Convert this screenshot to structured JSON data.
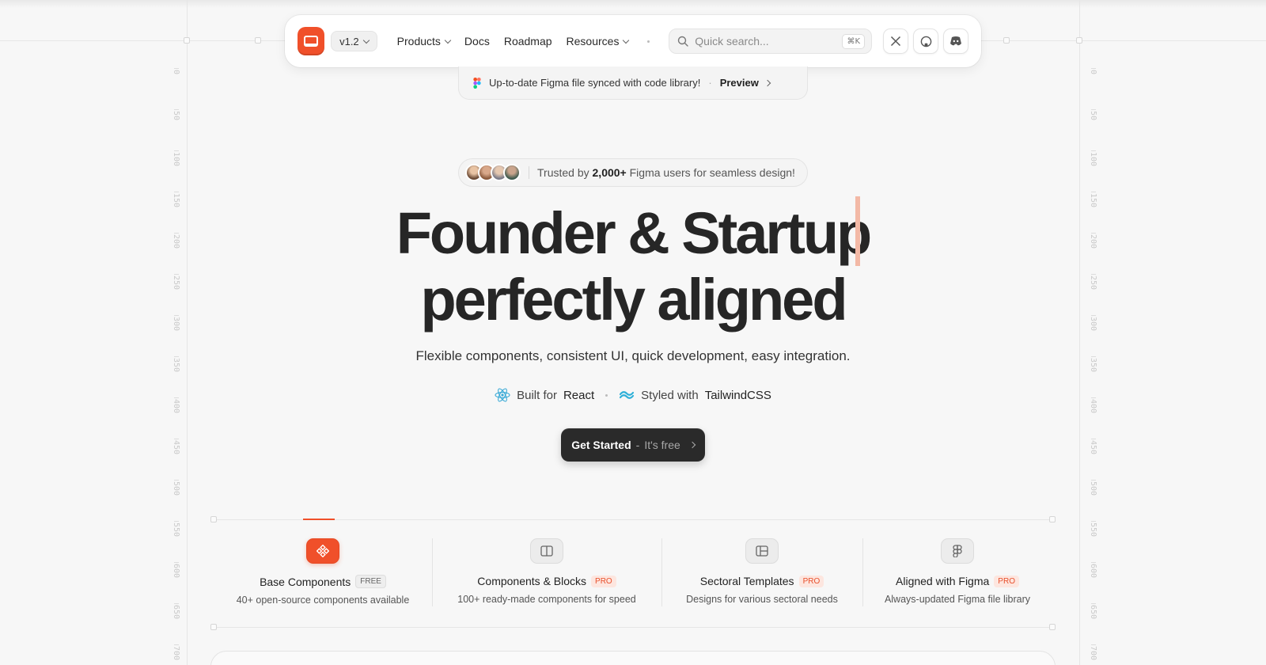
{
  "nav": {
    "version": "v1.2",
    "links": [
      {
        "label": "Products",
        "dropdown": true
      },
      {
        "label": "Docs",
        "dropdown": false
      },
      {
        "label": "Roadmap",
        "dropdown": false
      },
      {
        "label": "Resources",
        "dropdown": true
      }
    ],
    "search_placeholder": "Quick search...",
    "search_shortcut": "⌘K",
    "social": [
      "x-icon",
      "github-icon",
      "discord-icon"
    ]
  },
  "banner": {
    "text": "Up-to-date Figma file synced with code library!",
    "separator": "·",
    "link": "Preview"
  },
  "trusted": {
    "prefix": "Trusted by",
    "count": "2,000+",
    "suffix": "Figma users for seamless design!"
  },
  "hero": {
    "title_line1": "Founder & Startup",
    "title_line2": "perfectly aligned",
    "subtitle": "Flexible components, consistent UI, quick development, easy integration.",
    "built_prefix": "Built for",
    "built_name": "React",
    "styled_prefix": "Styled with",
    "styled_name": "TailwindCSS"
  },
  "cta": {
    "label": "Get Started",
    "sep": "-",
    "sub": "It's free"
  },
  "features": [
    {
      "title": "Base Components",
      "badge": "FREE",
      "desc": "40+ open-source components available",
      "icon": "components-icon"
    },
    {
      "title": "Components & Blocks",
      "badge": "PRO",
      "desc": "100+ ready-made components for speed",
      "icon": "blocks-icon"
    },
    {
      "title": "Sectoral Templates",
      "badge": "PRO",
      "desc": "Designs for various sectoral needs",
      "icon": "templates-icon"
    },
    {
      "title": "Aligned with Figma",
      "badge": "PRO",
      "desc": "Always-updated Figma file library",
      "icon": "figma-icon"
    }
  ],
  "ruler_ticks": [
    "0",
    "50",
    "100",
    "150",
    "200",
    "250",
    "300",
    "350",
    "400",
    "450",
    "500",
    "550",
    "600",
    "650",
    "700"
  ],
  "colors": {
    "accent": "#f0502a",
    "dark": "#2a2a2a",
    "pro_badge_bg": "#fde6df"
  }
}
